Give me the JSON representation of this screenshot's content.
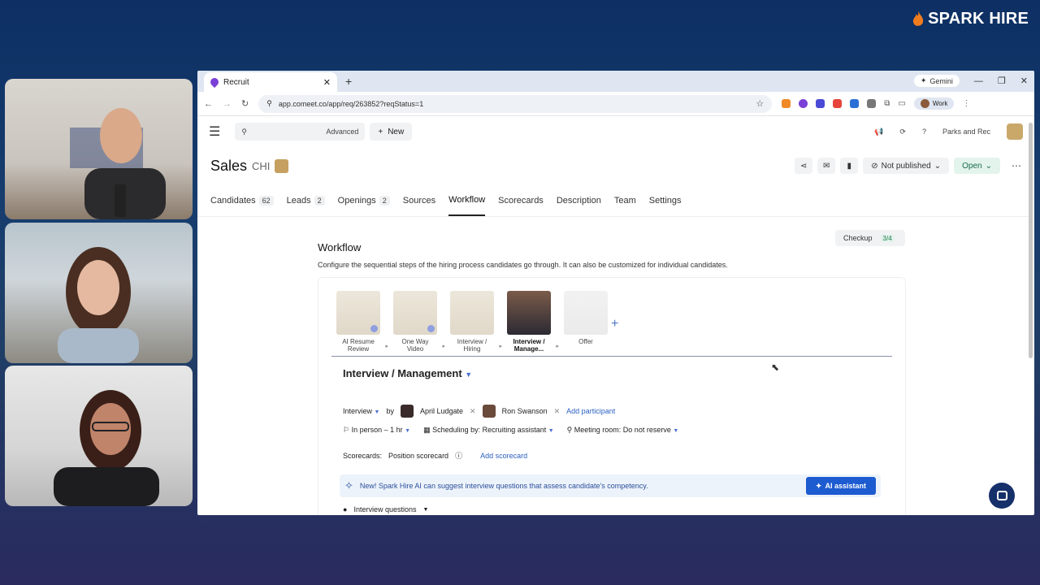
{
  "brand": {
    "name": "SPARK HIRE"
  },
  "browser": {
    "tab_title": "Recruit",
    "gemini_label": "Gemini",
    "url": "app.comeet.co/app/req/263852?reqStatus=1",
    "profile_label": "Work"
  },
  "app": {
    "search_advanced": "Advanced",
    "new_label": "New",
    "org_name": "Parks and Rec",
    "req_title": "Sales",
    "req_location": "CHI",
    "publish_status": "Not published",
    "open_status": "Open"
  },
  "nav_tabs": [
    {
      "label": "Candidates",
      "count": "62"
    },
    {
      "label": "Leads",
      "count": "2"
    },
    {
      "label": "Openings",
      "count": "2"
    },
    {
      "label": "Sources",
      "count": ""
    },
    {
      "label": "Workflow",
      "count": ""
    },
    {
      "label": "Scorecards",
      "count": ""
    },
    {
      "label": "Description",
      "count": ""
    },
    {
      "label": "Team",
      "count": ""
    },
    {
      "label": "Settings",
      "count": ""
    }
  ],
  "workflow": {
    "title": "Workflow",
    "description": "Configure the sequential steps of the hiring process candidates go through. It can also be customized for individual candidates.",
    "checkup_label": "Checkup",
    "checkup_count": "3/4",
    "steps": [
      {
        "line1": "AI Resume",
        "line2": "Review"
      },
      {
        "line1": "One Way",
        "line2": "Video"
      },
      {
        "line1": "Interview /",
        "line2": "Hiring"
      },
      {
        "line1": "Interview /",
        "line2": "Manage..."
      },
      {
        "line1": "Offer",
        "line2": ""
      }
    ],
    "stage_title": "Interview / Management",
    "interview_type": "Interview",
    "by_label": "by",
    "participant1": "April Ludgate",
    "participant2": "Ron Swanson",
    "add_participant": "Add participant",
    "location": "In person",
    "duration": "– 1 hr",
    "scheduling": "Scheduling by: Recruiting assistant",
    "meeting_room": "Meeting room: Do not reserve",
    "scorecards_label": "Scorecards:",
    "scorecard_name": "Position scorecard",
    "add_scorecard": "Add scorecard",
    "ai_banner": "New! Spark Hire AI can suggest interview questions that assess candidate's competency.",
    "ai_button": "AI assistant",
    "interview_questions": "Interview questions"
  },
  "colors": {
    "accent": "#1d5bd0",
    "link": "#2a5fc0",
    "brand_flame": "#f07c1e"
  }
}
